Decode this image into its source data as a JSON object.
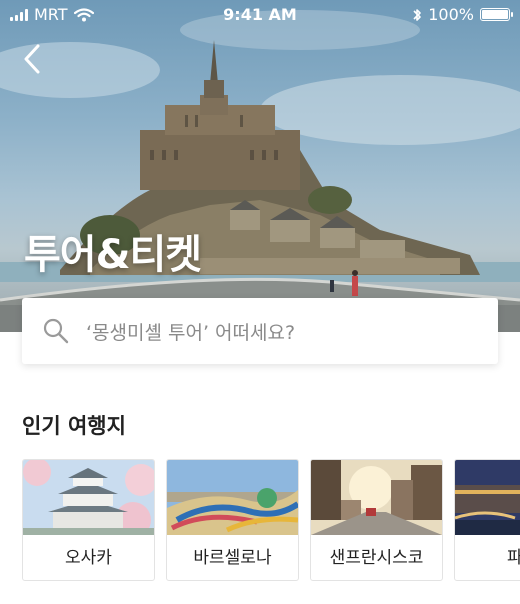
{
  "status_bar": {
    "carrier": "MRT",
    "time": "9:41 AM",
    "battery": "100%",
    "battery_level": 1.0,
    "icons": [
      "signal-icon",
      "wifi-icon",
      "bluetooth-icon",
      "battery-icon"
    ]
  },
  "nav": {
    "back_icon": "chevron-left-icon"
  },
  "hero": {
    "title": "투어&티켓"
  },
  "search": {
    "placeholder": "‘몽생미셸 투어’ 어떠세요?",
    "icon": "search-icon"
  },
  "popular": {
    "title": "인기 여행지",
    "destinations": [
      {
        "label": "오사카"
      },
      {
        "label": "바르셀로나"
      },
      {
        "label": "샌프란시스코"
      },
      {
        "label": "파"
      }
    ]
  },
  "colors": {
    "text": "#222222",
    "placeholder": "#8a8a8a",
    "border": "#e3e3e3",
    "white": "#ffffff"
  }
}
